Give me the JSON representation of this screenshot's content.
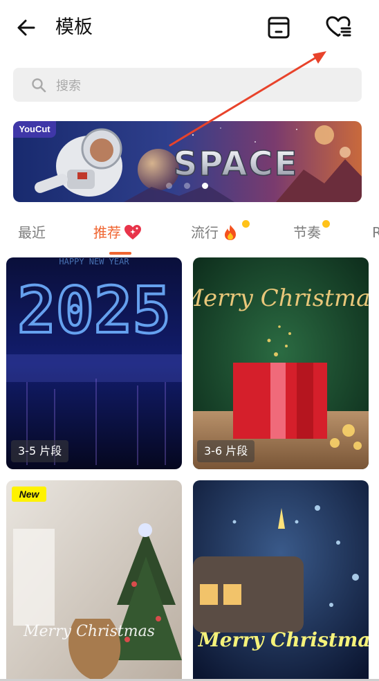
{
  "header": {
    "title": "模板",
    "back_icon": "arrow-left-icon",
    "drafts_icon": "template-box-icon",
    "favorites_icon": "heart-list-icon"
  },
  "search": {
    "placeholder": "搜索",
    "icon": "search-icon"
  },
  "banner": {
    "brand": "YouCut",
    "headline": "SPACE",
    "slide_count": 3,
    "active_slide": 3
  },
  "tabs": [
    {
      "label": "最近",
      "active": false,
      "icon": "",
      "dot": false
    },
    {
      "label": "推荐",
      "active": true,
      "icon": "sparkling-heart-icon",
      "dot": false
    },
    {
      "label": "流行",
      "active": false,
      "icon": "fire-icon",
      "dot": true
    },
    {
      "label": "节奏",
      "active": false,
      "icon": "",
      "dot": true
    },
    {
      "label": "R",
      "active": false,
      "icon": "",
      "dot": false
    }
  ],
  "templates": [
    {
      "clips": "3-5 片段",
      "subject": "2025",
      "badge": ""
    },
    {
      "clips": "3-6 片段",
      "subject": "Merry Christmas",
      "badge": ""
    },
    {
      "clips": "",
      "subject": "Merry Christmas",
      "badge": "New"
    },
    {
      "clips": "",
      "subject": "Merry Christmas",
      "badge": ""
    }
  ],
  "colors": {
    "accent": "#f06531",
    "notification_dot": "#ffc21a",
    "annotation_arrow": "#e8432b",
    "new_badge": "#fff200"
  }
}
